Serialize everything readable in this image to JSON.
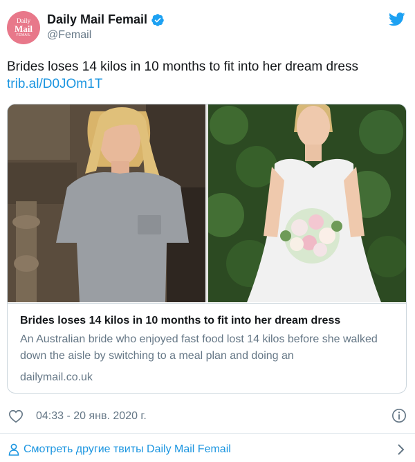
{
  "account": {
    "display_name": "Daily Mail Femail",
    "handle": "@Femail",
    "avatar_text": [
      "Daily",
      "Mail",
      "FEMAIL"
    ],
    "verified": true
  },
  "tweet": {
    "text": "Brides loses 14 kilos in 10 months to fit into her dream dress",
    "link": "trib.al/D0JOm1T"
  },
  "card": {
    "title": "Brides loses 14 kilos in 10 months to fit into her dream dress",
    "description": "An Australian bride who enjoyed fast food lost 14 kilos before she walked down the aisle by switching to a meal plan and doing an",
    "domain": "dailymail.co.uk"
  },
  "meta": {
    "timestamp": "04:33 - 20 янв. 2020 г."
  },
  "footer": {
    "more_tweets_label": "Смотреть другие твиты Daily Mail Femail"
  },
  "icons": {
    "verified": "verified-badge-icon",
    "platform": "twitter-bird-icon",
    "like": "heart-icon",
    "info": "info-icon",
    "profile": "person-icon",
    "next": "chevron-right-icon"
  },
  "colors": {
    "accent": "#1b95e0",
    "text_primary": "#14171a",
    "text_secondary": "#657786",
    "border": "#ccd6dd",
    "avatar_bg": "#e8788a"
  }
}
